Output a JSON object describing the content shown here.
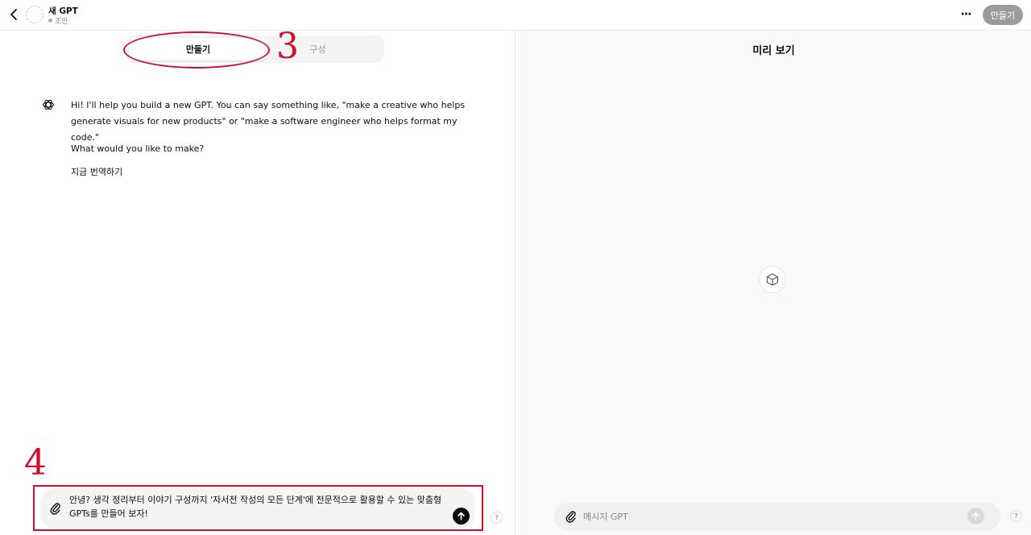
{
  "header": {
    "gpt_name": "새 GPT",
    "status": "초안",
    "more_label": "···",
    "create_button": "만들기"
  },
  "editor": {
    "tabs": [
      {
        "label": "만들기",
        "active": true
      },
      {
        "label": "구성",
        "active": false
      }
    ],
    "messages": [
      "Hi! I'll help you build a new GPT. You can say something like, \"make a creative who helps generate visuals for new products\" or \"make a software engineer who helps format my code.\"",
      "What would you like to make?",
      "지금 번역하기"
    ],
    "composer_text": "안녕? 생각 정리부터 이야기 구성까지 '자서전 작성의 모든 단계'에 전문적으로 활용할 수 있는 맞춤형 GPTs를 만들어 보자!",
    "help": "?"
  },
  "annotations": {
    "step3": "3",
    "step4": "4",
    "color": "#d0102a"
  },
  "preview": {
    "title": "미리 보기",
    "input_placeholder": "메시지 GPT",
    "help": "?"
  }
}
